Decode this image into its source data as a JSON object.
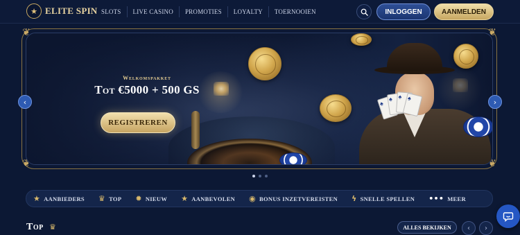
{
  "brand": {
    "name": "ELITE SPIN",
    "logo_icon": "star-crown-icon"
  },
  "nav": {
    "items": [
      {
        "label": "SLOTS"
      },
      {
        "label": "LIVE CASINO"
      },
      {
        "label": "PROMOTIES"
      },
      {
        "label": "LOYALTY"
      },
      {
        "label": "TOERNOOIEN"
      }
    ]
  },
  "header": {
    "search_icon": "search-icon",
    "login_label": "INLOGGEN",
    "register_label": "AANMELDEN"
  },
  "hero": {
    "subtitle": "Welkomspakket",
    "title": "Tot €5000 + 500 GS",
    "cta_label": "REGISTREREN",
    "slide_count": 3,
    "active_slide": 1
  },
  "categories": [
    {
      "icon": "star-icon",
      "label": "AANBIEDERS"
    },
    {
      "icon": "crown-icon",
      "label": "TOP"
    },
    {
      "icon": "new-badge-icon",
      "label": "NIEUW"
    },
    {
      "icon": "star-icon",
      "label": "AANBEVOLEN"
    },
    {
      "icon": "coin-icon",
      "label": "BONUS INZETVEREISTEN"
    },
    {
      "icon": "lightning-icon",
      "label": "SNELLE SPELLEN"
    },
    {
      "icon": "more-dots-icon",
      "label": "MEER"
    }
  ],
  "section": {
    "title": "Top",
    "see_all_label": "ALLES BEKIJKEN"
  },
  "colors": {
    "background": "#0c1834",
    "gold": "#d8b86c",
    "login_blue": "#2e4f96",
    "chat_blue": "#2557c4"
  }
}
